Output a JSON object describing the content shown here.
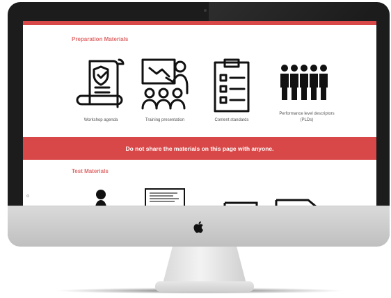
{
  "screen": {
    "preparation": {
      "title": "Preparation Materials",
      "items": [
        {
          "label": "Workshop agenda",
          "icon": "document-scroll-shield-icon"
        },
        {
          "label": "Training presentation",
          "icon": "presenter-with-audience-icon"
        },
        {
          "label": "Content standards",
          "icon": "clipboard-checklist-icon"
        },
        {
          "label_line1": "Performance level descriptors",
          "label_line2": "(PLDs)",
          "icon": "people-group-icon"
        }
      ]
    },
    "banner": {
      "text": "Do not share the materials on this page with anyone."
    },
    "test": {
      "title": "Test Materials",
      "items": [
        {
          "icon": "person-icon"
        },
        {
          "icon": "text-document-icon"
        },
        {
          "icon": "laptop-icon"
        },
        {
          "icon": "folded-page-icon"
        }
      ]
    }
  },
  "colors": {
    "accent_red": "#d94848",
    "section_title": "#e06a6a",
    "icon_stroke": "#111111"
  },
  "device": {
    "logo": "apple-logo-icon"
  }
}
